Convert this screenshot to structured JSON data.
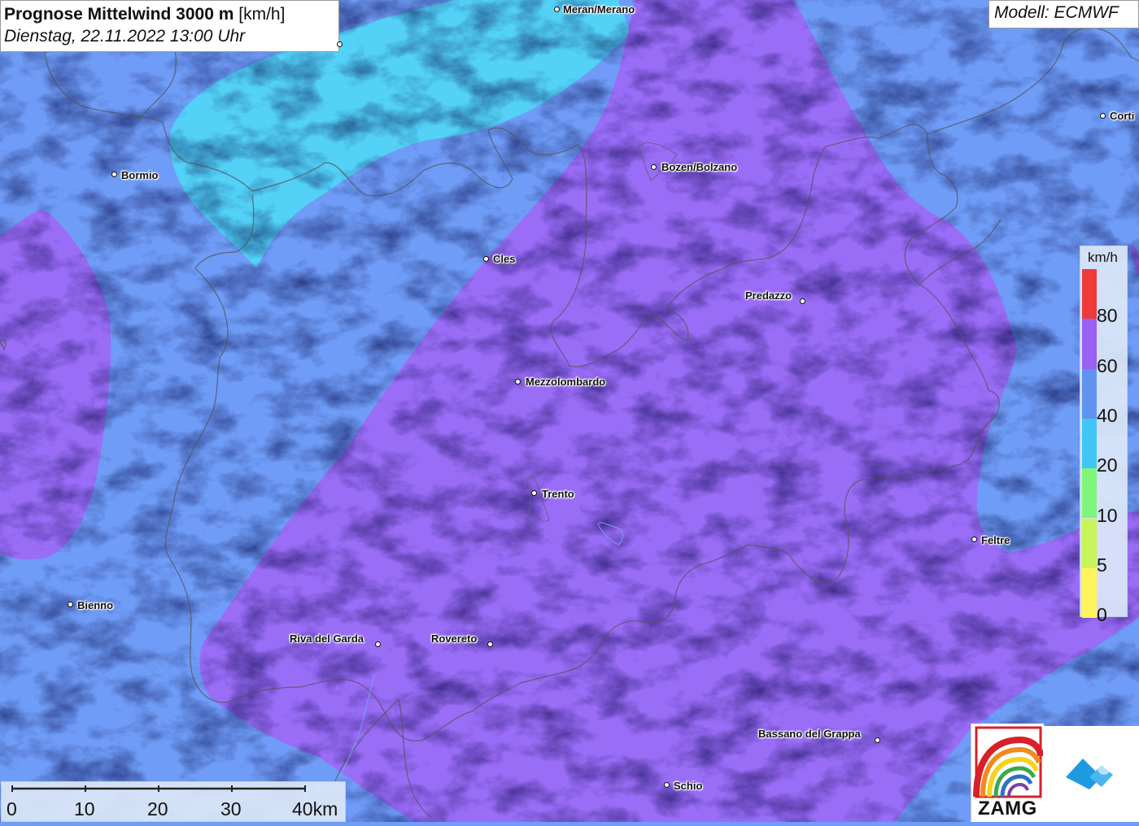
{
  "title": {
    "main": "Prognose Mittelwind 3000 m",
    "unit": "[km/h]",
    "date": "Dienstag, 22.11.2022 13:00 Uhr"
  },
  "model": "Modell: ECMWF",
  "cities": [
    {
      "name": "Meran/Merano",
      "id": "meran"
    },
    {
      "name": "Bozen/Bolzano",
      "id": "bozen"
    },
    {
      "name": "Bormio",
      "id": "bormio"
    },
    {
      "name": "Cles",
      "id": "cles"
    },
    {
      "name": "Predazzo",
      "id": "predazzo"
    },
    {
      "name": "Mezzolombardo",
      "id": "mezzolombardo"
    },
    {
      "name": "Trento",
      "id": "trento"
    },
    {
      "name": "Feltre",
      "id": "feltre"
    },
    {
      "name": "Bienno",
      "id": "bienno"
    },
    {
      "name": "Riva del Garda",
      "id": "riva"
    },
    {
      "name": "Rovereto",
      "id": "rovereto"
    },
    {
      "name": "Bassano del Grappa",
      "id": "bassano"
    },
    {
      "name": "Schio",
      "id": "schio"
    },
    {
      "name": "Corti",
      "id": "cortina"
    }
  ],
  "legend": {
    "unit": "km/h",
    "ticks": [
      "80",
      "60",
      "40",
      "20",
      "10",
      "5",
      "0"
    ],
    "colors": [
      "#f03a3a",
      "#9a5ff3",
      "#5f93ef",
      "#3fc6f4",
      "#7ff57c",
      "#c7f557",
      "#fff35b"
    ]
  },
  "scale": {
    "labels": [
      "0",
      "10",
      "20",
      "30",
      "40km"
    ]
  },
  "colors": {
    "band_40_60": "#6f9cf6",
    "band_60_80": "#9a6df7",
    "band_20_40": "#53d1f7"
  },
  "logos": {
    "zamg": "ZAMG"
  }
}
